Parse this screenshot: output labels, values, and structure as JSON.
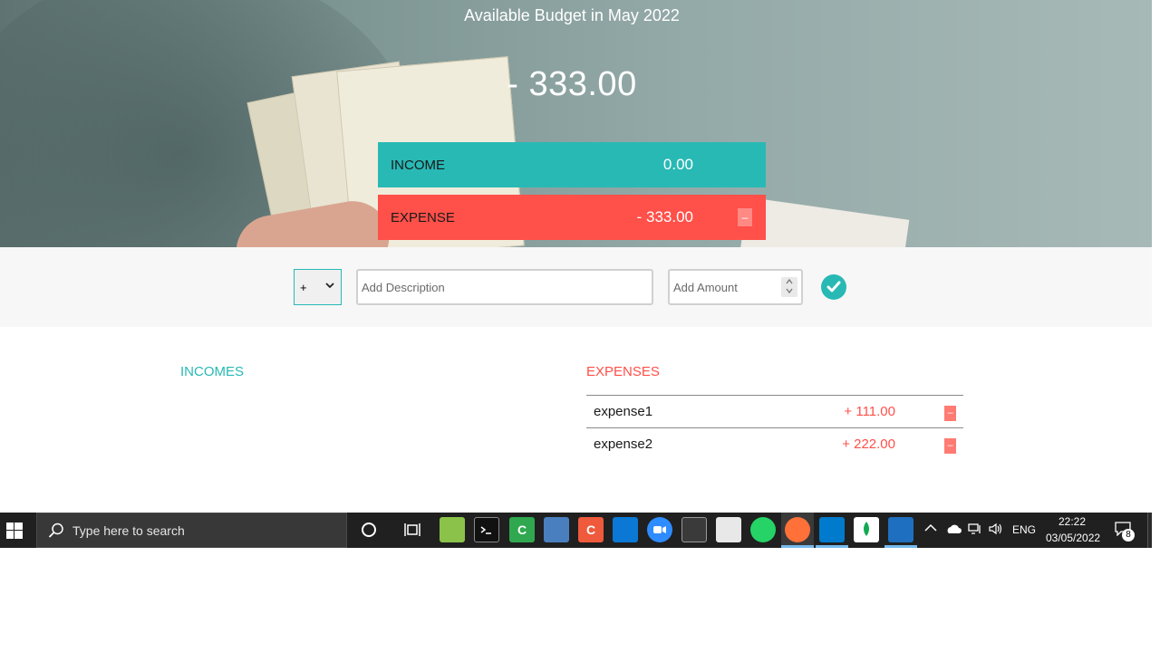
{
  "hero": {
    "title": "Available Budget in May 2022",
    "budget": "- 333.00"
  },
  "summary": {
    "income_label": "INCOME",
    "income_value": "0.00",
    "expense_label": "EXPENSE",
    "expense_value": "- 333.00",
    "expense_delete": "–"
  },
  "add_bar": {
    "type_value": "+",
    "description_placeholder": "Add Description",
    "amount_placeholder": "Add Amount",
    "submit_icon": "check-circle-icon"
  },
  "incomes": {
    "title": "INCOMES",
    "items": []
  },
  "expenses": {
    "title": "EXPENSES",
    "items": [
      {
        "description": "expense1",
        "amount": "+ 111.00",
        "delete": "–"
      },
      {
        "description": "expense2",
        "amount": "+ 222.00",
        "delete": "–"
      }
    ]
  },
  "taskbar": {
    "search_placeholder": "Type here to search",
    "language": "ENG",
    "time": "22:22",
    "date": "03/05/2022",
    "notification_count": "8",
    "pinned": [
      "cortana-icon",
      "task-view-icon",
      "notepad-icon",
      "terminal-icon",
      "camtasia-icon",
      "paint-icon",
      "app-c-icon",
      "store-icon",
      "zoom-icon",
      "console-icon",
      "reader-icon",
      "whatsapp-icon",
      "firefox-icon",
      "vscode-icon",
      "mongodb-icon",
      "photos-icon"
    ]
  },
  "colors": {
    "income": "#28b9b5",
    "expense": "#ff5049",
    "taskbar": "#202020"
  }
}
